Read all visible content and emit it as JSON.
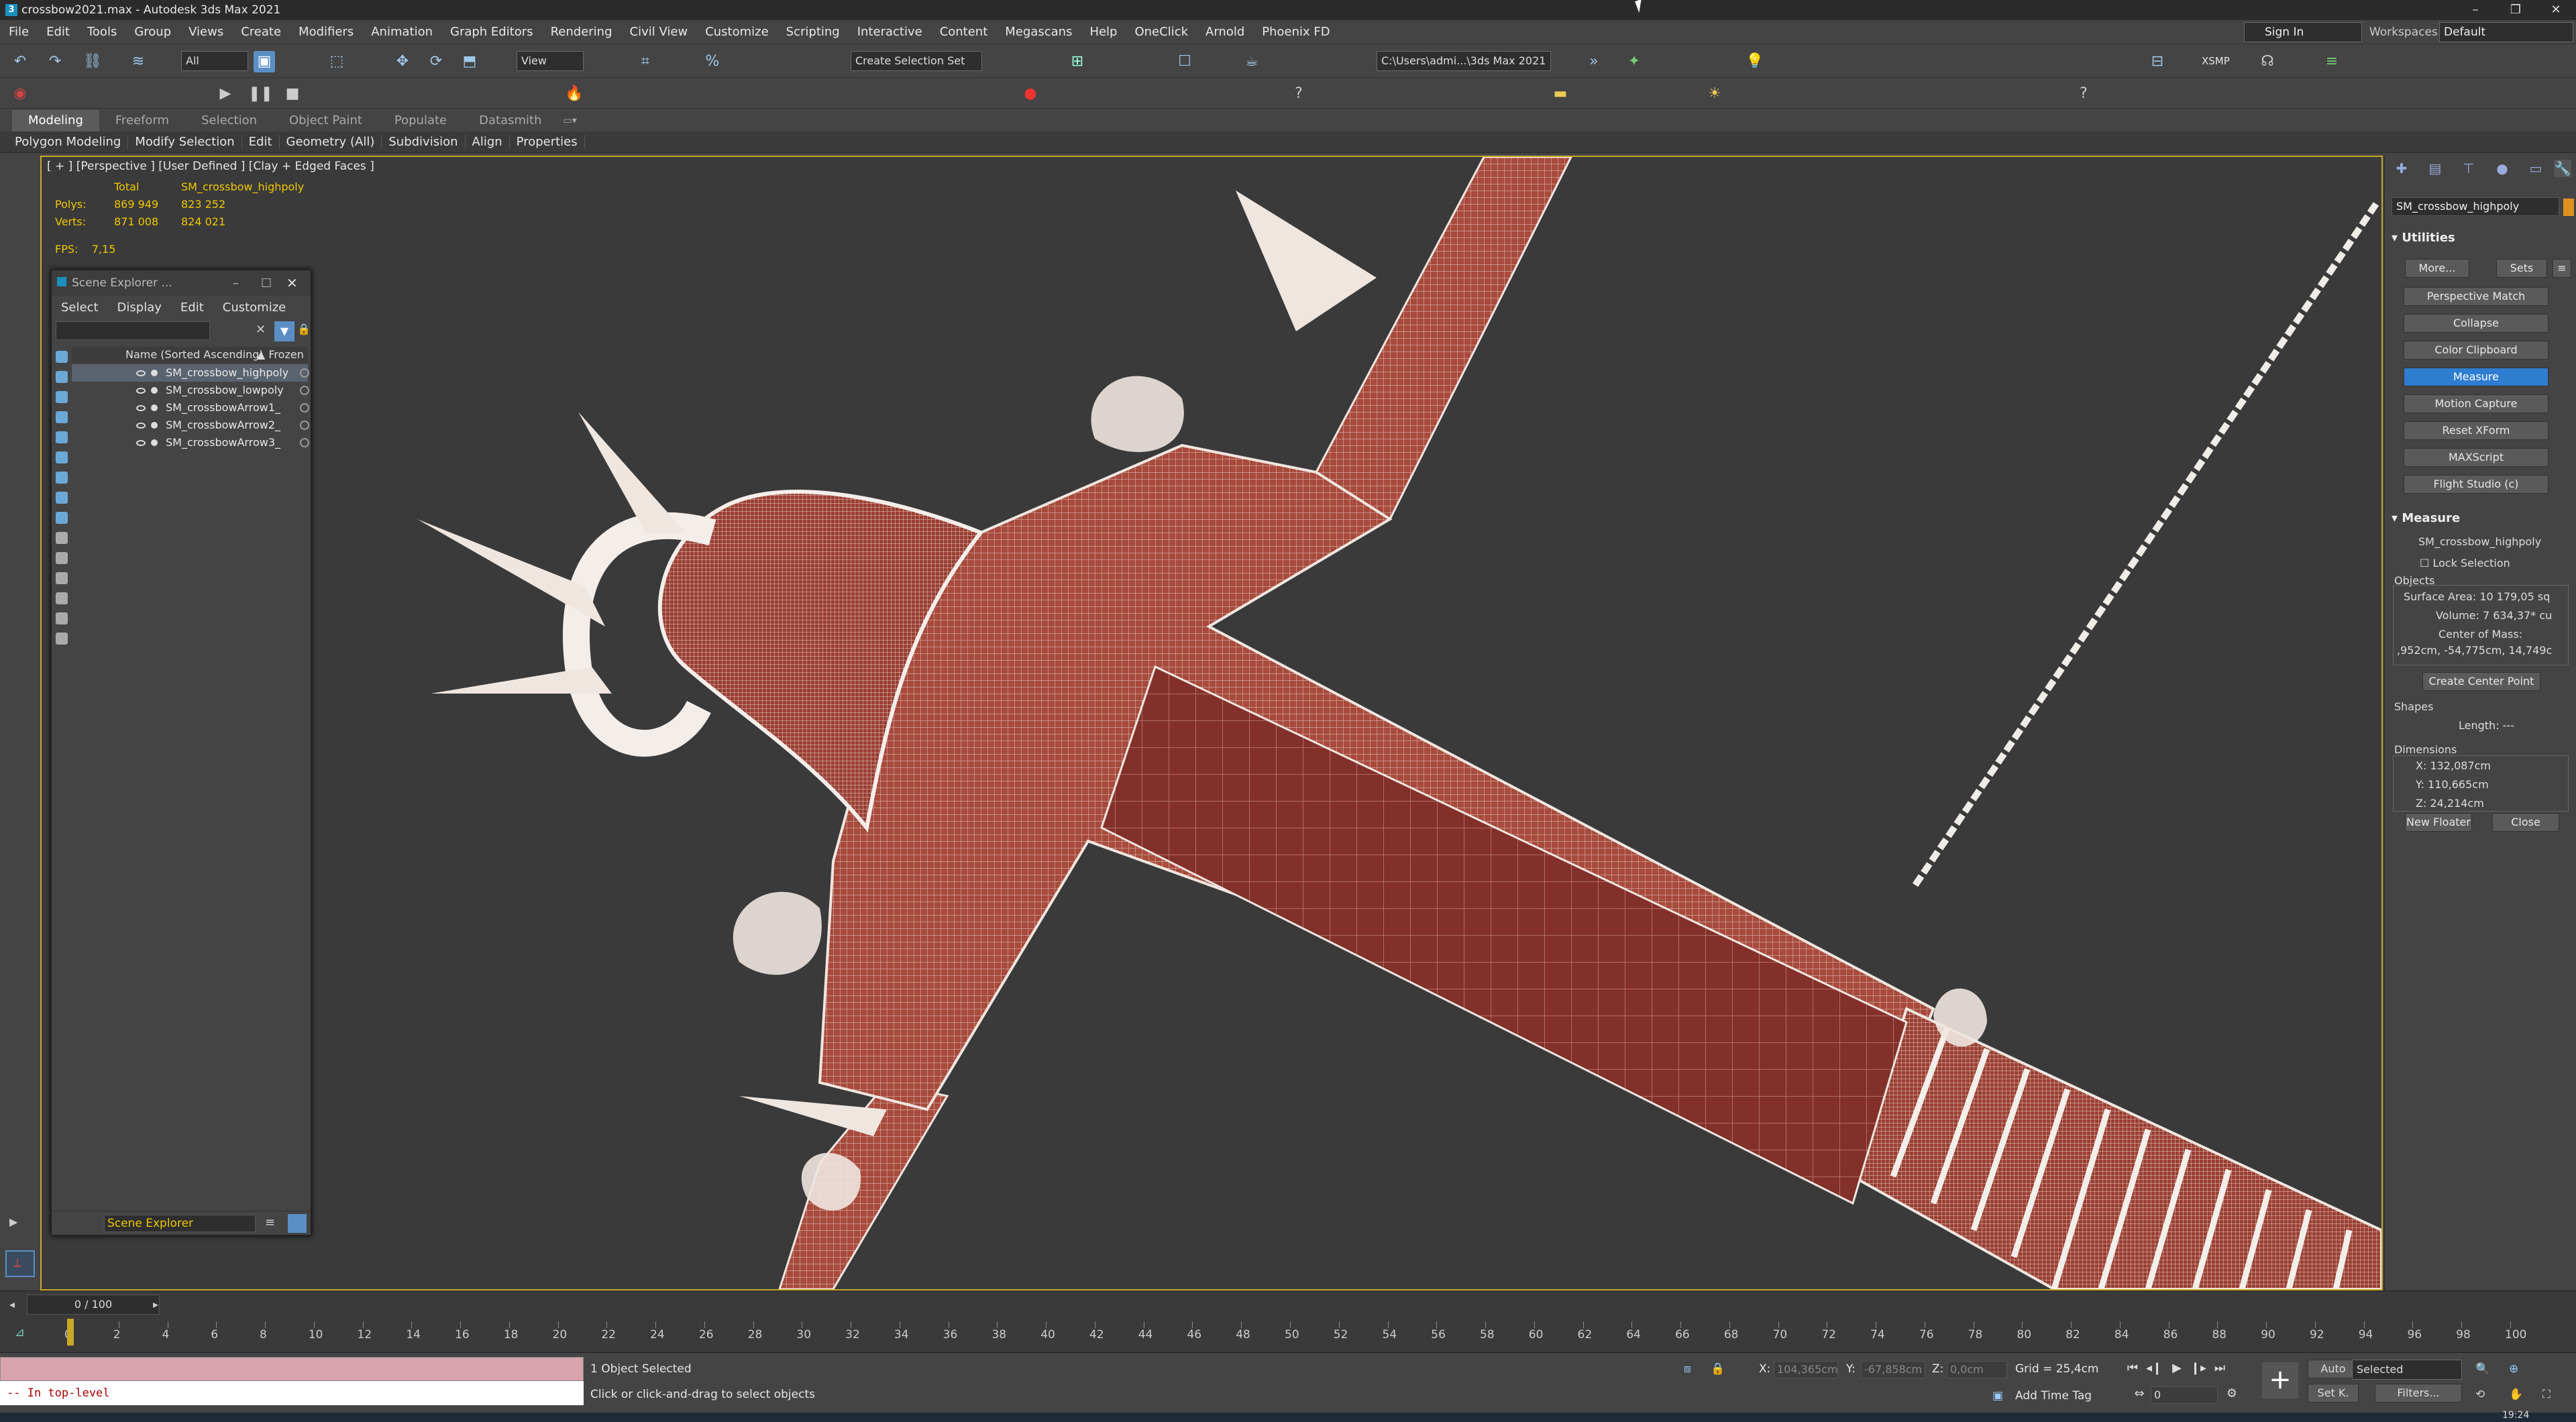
{
  "window": {
    "title": "crossbow2021.max - Autodesk 3ds Max 2021",
    "controls": [
      "–",
      "❐",
      "✕"
    ]
  },
  "menu": [
    "File",
    "Edit",
    "Tools",
    "Group",
    "Views",
    "Create",
    "Modifiers",
    "Animation",
    "Graph Editors",
    "Rendering",
    "Civil View",
    "Customize",
    "Scripting",
    "Interactive",
    "Content",
    "Megascans",
    "Help",
    "OneClick",
    "Arnold",
    "Phoenix FD"
  ],
  "account": {
    "signin": "Sign In",
    "workspaces_label": "Workspaces:",
    "workspace": "Default"
  },
  "toolbar": {
    "filter": "All",
    "ref_coord": "View",
    "selection_set": "Create Selection Set",
    "path": "C:\\Users\\admi...\\3ds Max 2021",
    "xsmp": "XSMP"
  },
  "ribbon": {
    "tabs": [
      "Modeling",
      "Freeform",
      "Selection",
      "Object Paint",
      "Populate",
      "Datasmith"
    ],
    "panels": [
      "Polygon Modeling",
      "Modify Selection",
      "Edit",
      "Geometry (All)",
      "Subdivision",
      "Align",
      "Properties"
    ]
  },
  "viewport": {
    "label": "[ + ] [Perspective ] [User Defined ] [Clay + Edged Faces ]",
    "stats": {
      "total_label": "Total",
      "object": "SM_crossbow_highpoly",
      "polys_label": "Polys:",
      "polys_total": "869 949",
      "polys_obj": "823 252",
      "verts_label": "Verts:",
      "verts_total": "871 008",
      "verts_obj": "824 021"
    },
    "fps_label": "FPS:",
    "fps": "7,15"
  },
  "scene_explorer": {
    "title": "Scene Explorer ...",
    "menu": [
      "Select",
      "Display",
      "Edit",
      "Customize"
    ],
    "col_name": "Name (Sorted Ascending)",
    "col_frozen": "▲ Frozen",
    "items": [
      {
        "name": "SM_crossbow_highpoly",
        "selected": true
      },
      {
        "name": "SM_crossbow_lowpoly",
        "selected": false
      },
      {
        "name": "SM_crossbowArrow1_",
        "selected": false
      },
      {
        "name": "SM_crossbowArrow2_",
        "selected": false
      },
      {
        "name": "SM_crossbowArrow3_",
        "selected": false
      }
    ],
    "footer": "Scene Explorer"
  },
  "command_panel": {
    "object_name": "SM_crossbow_highpoly",
    "object_color": "#e09020",
    "utilities_title": "Utilities",
    "more": "More...",
    "sets": "Sets",
    "buttons": [
      "Perspective Match",
      "Collapse",
      "Color Clipboard",
      "Measure",
      "Motion Capture",
      "Reset XForm",
      "MAXScript",
      "Flight Studio (c)"
    ],
    "active_button": "Measure",
    "measure_title": "Measure",
    "measure_object": "SM_crossbow_highpoly",
    "lock_selection": "Lock Selection",
    "objects_label": "Objects",
    "surface_area": "Surface Area:  10 179,05 sq",
    "volume": "Volume:  7 634,37* cu",
    "center_mass_label": "Center of Mass:",
    "center_mass": ",952cm, -54,775cm, 14,749c",
    "create_center": "Create Center Point",
    "shapes_label": "Shapes",
    "length": "Length:  ---",
    "dimensions_label": "Dimensions",
    "dim_x": "X:  132,087cm",
    "dim_y": "Y:  110,665cm",
    "dim_z": "Z:  24,214cm",
    "new_floater": "New Floater",
    "close": "Close"
  },
  "timeline": {
    "slider": "0 / 100",
    "ticks": [
      "0",
      "2",
      "4",
      "6",
      "8",
      "10",
      "12",
      "14",
      "16",
      "18",
      "20",
      "22",
      "24",
      "26",
      "28",
      "30",
      "32",
      "34",
      "36",
      "38",
      "40",
      "42",
      "44",
      "46",
      "48",
      "50",
      "52",
      "54",
      "56",
      "58",
      "60",
      "62",
      "64",
      "66",
      "68",
      "70",
      "72",
      "74",
      "76",
      "78",
      "80",
      "82",
      "84",
      "86",
      "88",
      "90",
      "92",
      "94",
      "96",
      "98",
      "100"
    ]
  },
  "status": {
    "maxscript": "-- In top-level",
    "selected": "1 Object Selected",
    "prompt": "Click or click-and-drag to select objects",
    "x_label": "X:",
    "x": "104,365cm",
    "y_label": "Y:",
    "y": "-67,858cm",
    "z_label": "Z:",
    "z": "0,0cm",
    "grid": "Grid = 25,4cm",
    "time_tag": "Add Time Tag",
    "auto": "Auto",
    "selected_combo": "Selected",
    "set_key": "Set K.",
    "filters": "Filters...",
    "frame": "0",
    "clock": "19:24"
  },
  "colors": {
    "accent": "#2f7dd0",
    "mesh": "#b05040",
    "wire": "#f0e6e0",
    "viewport_bg": "#3a3a3a"
  }
}
